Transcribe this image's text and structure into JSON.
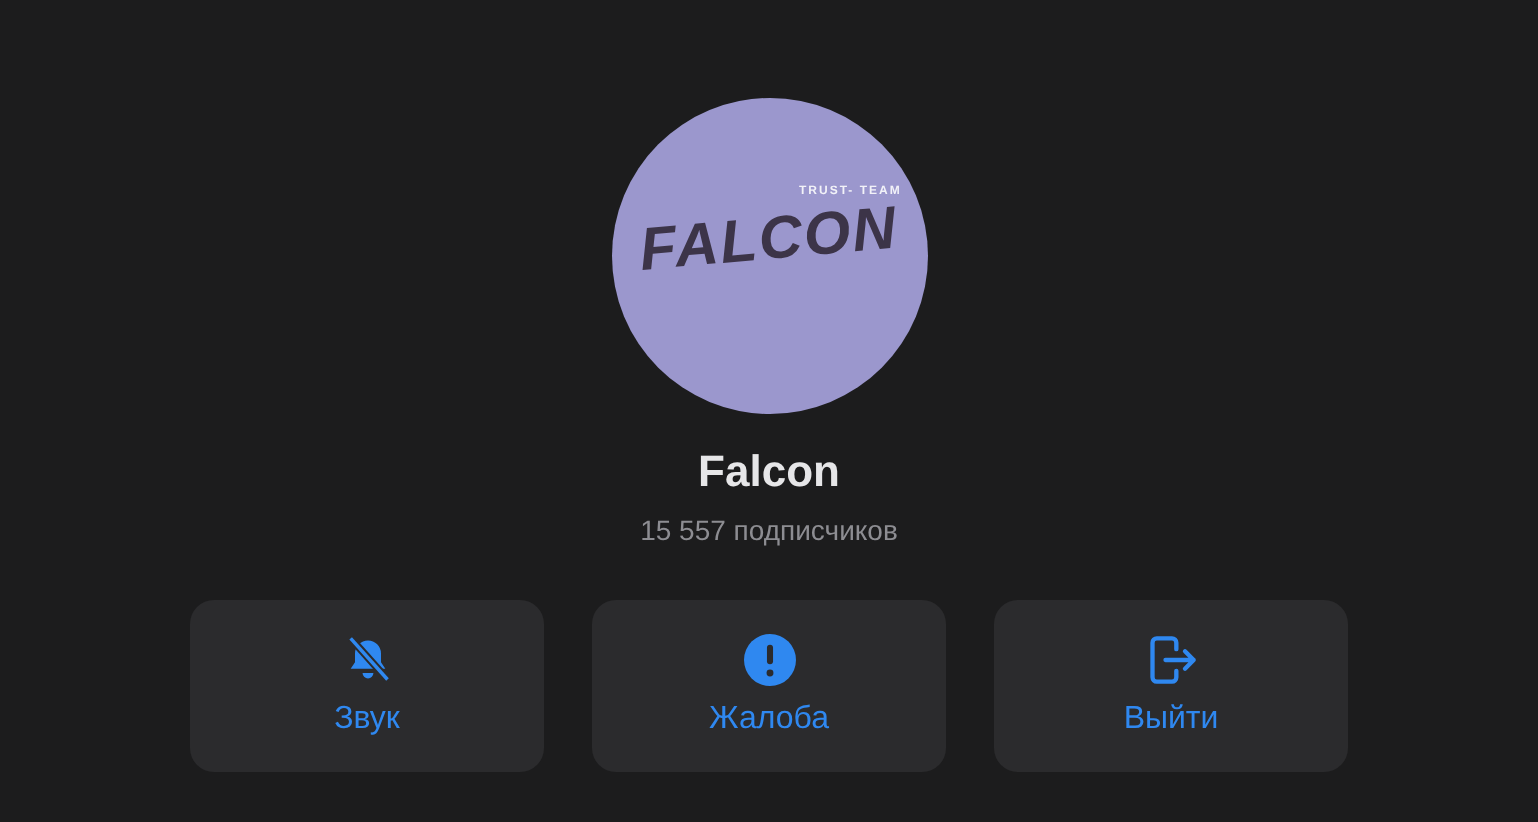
{
  "channel": {
    "avatar": {
      "logo_title": "FALCON",
      "logo_subtitle": "TRUST- TEAM"
    },
    "name": "Falcon",
    "subscribers": "15 557 подписчиков"
  },
  "actions": [
    {
      "kind": "mute",
      "label": "Звук"
    },
    {
      "kind": "report",
      "label": "Жалоба"
    },
    {
      "kind": "leave",
      "label": "Выйти"
    }
  ]
}
